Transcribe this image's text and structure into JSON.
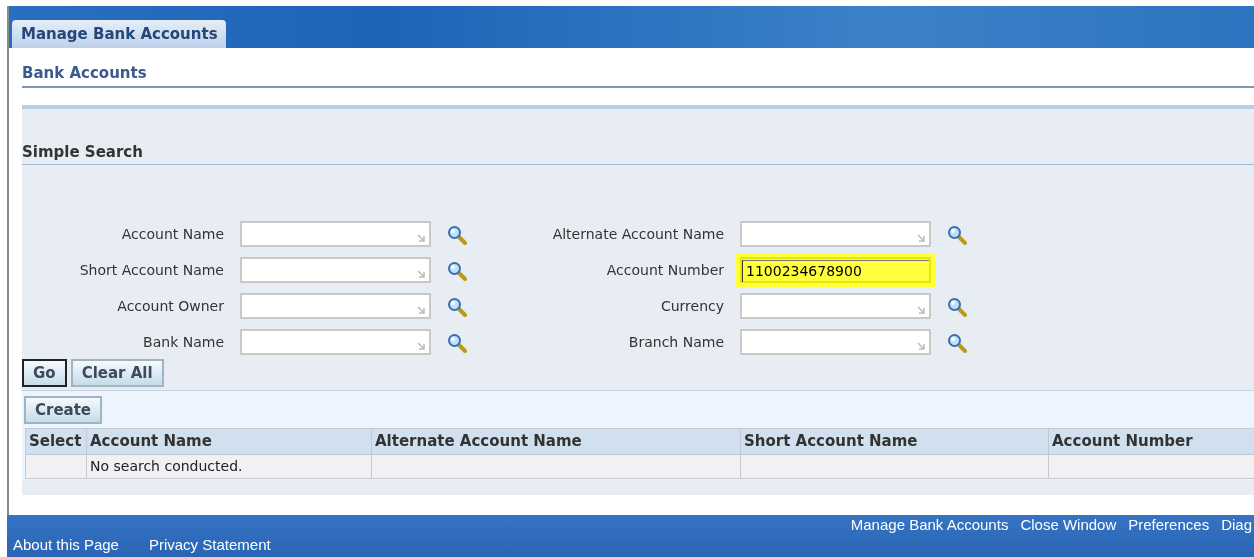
{
  "tabs": [
    {
      "label": "Manage Bank Accounts",
      "selected": true
    }
  ],
  "page_title": "Bank Accounts",
  "search": {
    "title": "Simple Search",
    "fields": [
      {
        "label": "Account Name",
        "lookup": true,
        "highlighted": false
      },
      {
        "label": "Alternate Account Name",
        "lookup": true,
        "highlighted": false
      },
      {
        "label": "Short Account Name",
        "lookup": true,
        "highlighted": false
      },
      {
        "label": "Account Number",
        "value": "1100234678900",
        "lookup": false,
        "highlighted": true
      },
      {
        "label": "Account Owner",
        "lookup": true,
        "highlighted": false
      },
      {
        "label": "Currency",
        "lookup": true,
        "highlighted": false
      },
      {
        "label": "Bank Name",
        "lookup": true,
        "highlighted": false
      },
      {
        "label": "Branch Name",
        "lookup": true,
        "highlighted": false
      }
    ],
    "buttons": [
      {
        "label": "Go",
        "focused": true
      },
      {
        "label": "Clear All",
        "focused": false
      }
    ]
  },
  "results": {
    "buttons": [
      {
        "label": "Create"
      }
    ],
    "columns": [
      "Select",
      "Account Name",
      "Alternate Account Name",
      "Short Account Name",
      "Account Number"
    ],
    "empty_message": "No search conducted."
  },
  "footer": {
    "links": [
      "Manage Bank Accounts",
      "Close Window",
      "Preferences",
      "Diag"
    ],
    "bottom_links": [
      "About this Page",
      "Privacy Statement"
    ]
  }
}
